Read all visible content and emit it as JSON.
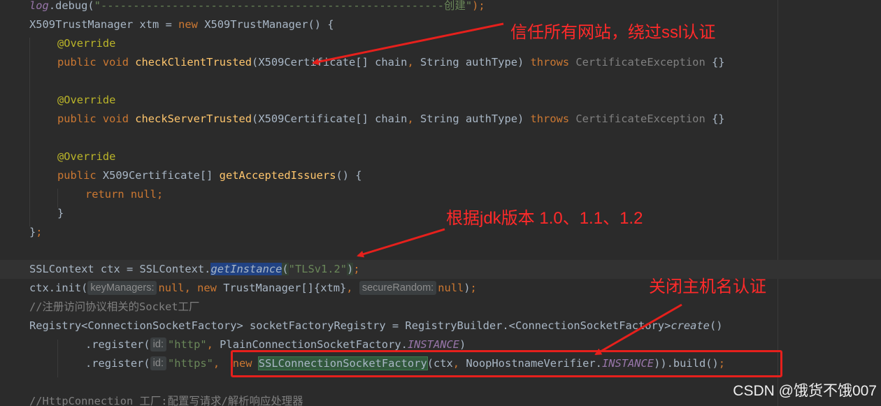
{
  "code_lines": {
    "l1": {
      "log": "log",
      "rest1": ".debug(",
      "str": "\"-----------------------------------------------------创建\"",
      "rest2": ");"
    },
    "l2": {
      "a": "X509TrustManager xtm = ",
      "kw": "new",
      "b": " X509TrustManager() {"
    },
    "l3": {
      "ann": "@Override"
    },
    "l4": {
      "kw1": "public",
      "kw2": "void",
      "method": "checkClientTrusted",
      "a": "(X509Certificate[] chain",
      "c1": ",",
      "b": " String authType) ",
      "throws": "throws",
      "exc": " CertificateException",
      "end": " {}"
    },
    "l5": {},
    "l6": {
      "ann": "@Override"
    },
    "l7": {
      "kw1": "public",
      "kw2": "void",
      "method": "checkServerTrusted",
      "a": "(X509Certificate[] chain",
      "c1": ",",
      "b": " String authType) ",
      "throws": "throws",
      "exc": " CertificateException",
      "end": " {}"
    },
    "l8": {},
    "l9": {
      "ann": "@Override"
    },
    "l10": {
      "kw1": "public",
      "a": " X509Certificate[] ",
      "method": "getAcceptedIssuers",
      "b": "() {"
    },
    "l11": {
      "kw": "return",
      "kw2": " null",
      "end": ";"
    },
    "l12": {
      "a": "}"
    },
    "l13": {
      "a": "}",
      "end": ";"
    },
    "l14": {},
    "l15": {
      "a": "SSLContext ctx = SSLContext.",
      "sel": "getInstance",
      "b": "(",
      "str": "\"TLSv1.2\"",
      "c": ")",
      "end": ";"
    },
    "l16": {
      "a": "ctx.init(",
      "hint1": "keyManagers:",
      "kw1": "null",
      "c1": ",",
      "sp": " ",
      "kw2": "new",
      "b": " TrustManager[]{xtm}",
      "c2": ",",
      "hint2": "secureRandom:",
      "kw3": "null",
      "c": ")",
      "end": ";"
    },
    "l17": {
      "cmt": "//注册访问协议相关的Socket工厂"
    },
    "l18": {
      "a": "Registry<ConnectionSocketFactory> socketFactoryRegistry = RegistryBuilder.<ConnectionSocketFactory>",
      "create": "create",
      "b": "()"
    },
    "l19": {
      "a": ".register(",
      "hint": "id:",
      "str": "\"http\"",
      "c1": ",",
      "b": " PlainConnectionSocketFactory.",
      "static": "INSTANCE",
      "c": ")"
    },
    "l20": {
      "a": ".register(",
      "hint": "id:",
      "str": "\"https\"",
      "c1": ",",
      "kw": "new",
      "box": "SSLConnectionSocketFactory",
      "b": "(ctx",
      "c2": ",",
      "d": " NoopHostnameVerifier.",
      "static": "INSTANCE",
      "e": ")).build()",
      "end": ";"
    },
    "l21": {},
    "l22": {
      "cmt": "//HttpConnection 工厂:配置写请求/解析响应处理器"
    }
  },
  "annotations": {
    "trust_all": "信任所有网站，绕过ssl认证",
    "jdk_version": "根据jdk版本 1.0、1.1、1.2",
    "hostname": "关闭主机名认证"
  },
  "colors": {
    "background": "#2b2b2b",
    "annotation_red": "#ff2a2a",
    "keyword": "#cc7832",
    "string": "#6a8759",
    "method": "#ffc66d"
  },
  "watermark": "CSDN @饿货不饿007"
}
